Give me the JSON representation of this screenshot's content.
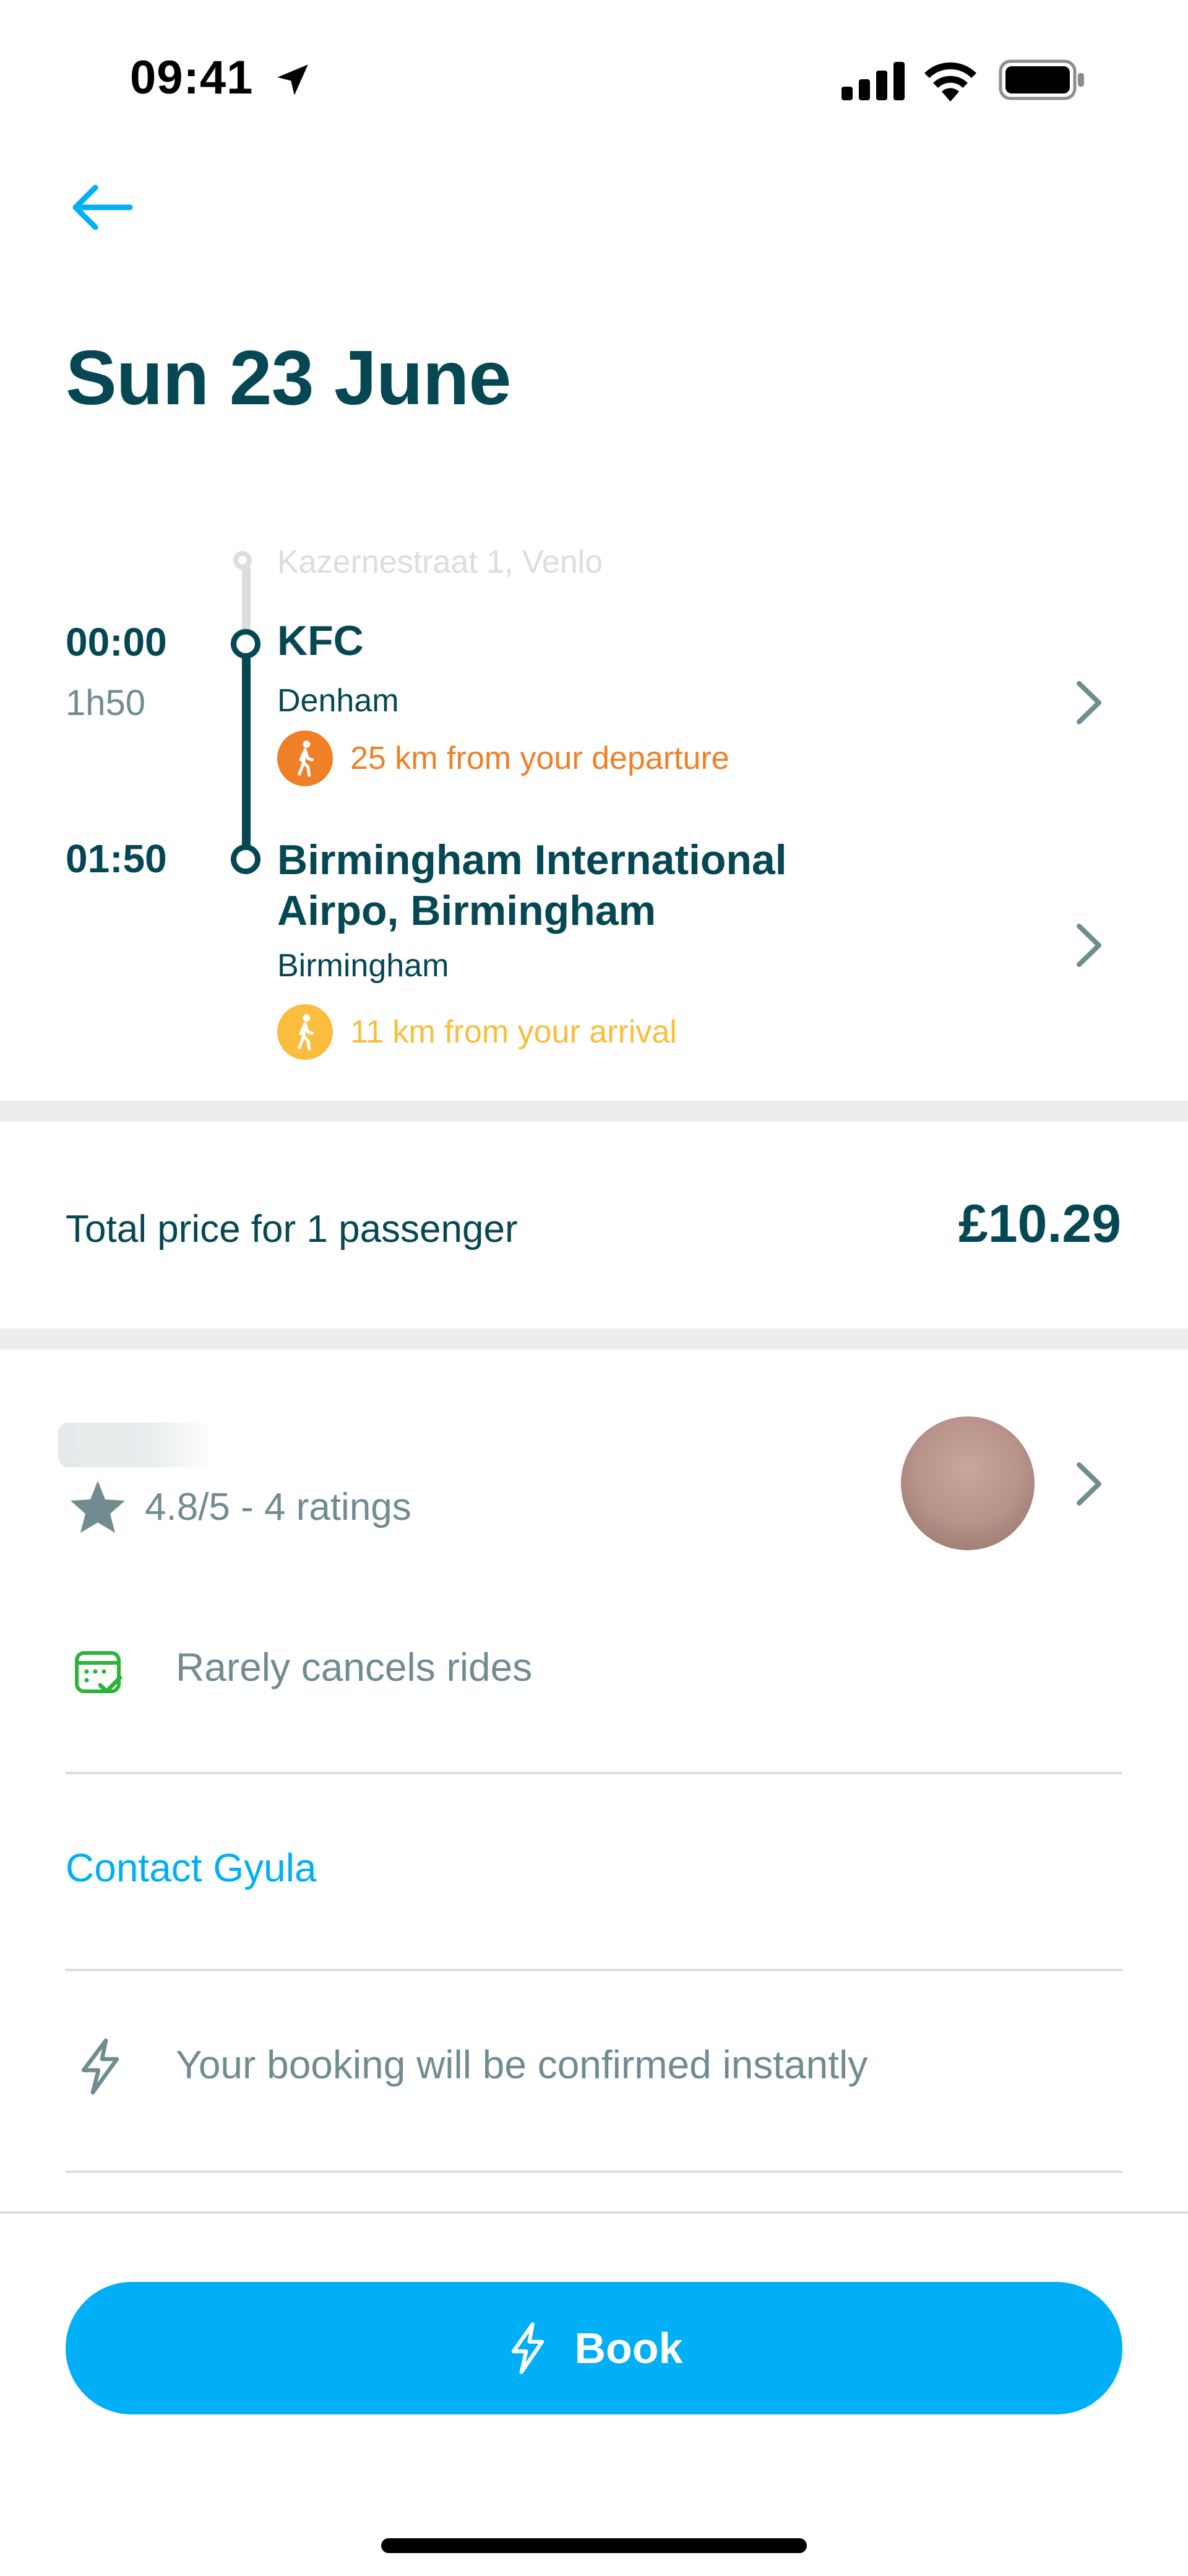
{
  "status_bar": {
    "time": "09:41"
  },
  "header": {
    "date_title": "Sun 23 June"
  },
  "itinerary": {
    "previous_stop": "Kazernestraat 1, Venlo",
    "departure": {
      "time": "00:00",
      "duration": "1h50",
      "name": "KFC",
      "city": "Denham",
      "walk_text": "25 km from your departure",
      "walk_color": "#ef8027"
    },
    "arrival": {
      "time": "01:50",
      "name_line1": "Birmingham International",
      "name_line2": "Airpo, Birmingham",
      "city": "Birmingham",
      "walk_text": "11 km from your arrival",
      "walk_color": "#fbbd3e"
    }
  },
  "price": {
    "label": "Total price for 1 passenger",
    "amount": "£10.29"
  },
  "driver": {
    "rating_text": "4.8/5 - 4 ratings",
    "badge_text": "Rarely cancels rides",
    "contact_label": "Contact Gyula"
  },
  "booking": {
    "instant_text": "Your booking will be confirmed instantly",
    "button_label": "Book"
  },
  "colors": {
    "primary_text": "#054752",
    "secondary_text": "#708c91",
    "accent": "#00aff5",
    "badge_green": "#2eb33a"
  }
}
